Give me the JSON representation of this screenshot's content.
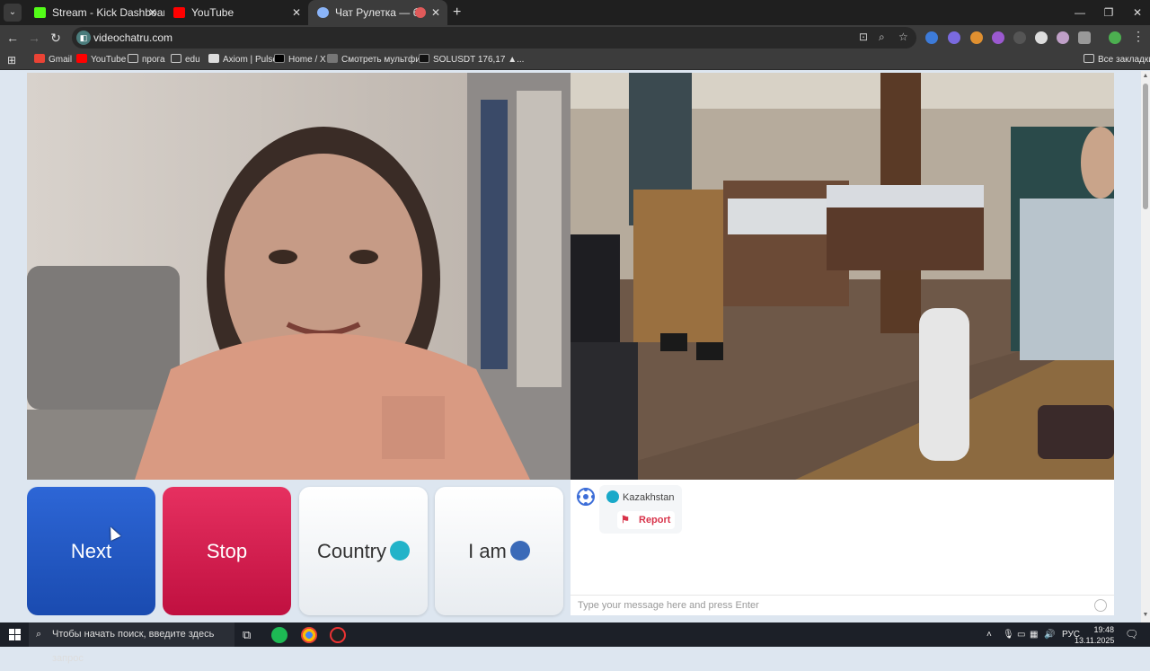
{
  "browser": {
    "tabs": [
      {
        "title": "Stream - Kick Dashboard",
        "favicon": "kick-icon",
        "color": "#53fc18"
      },
      {
        "title": "YouTube",
        "favicon": "youtube-icon",
        "color": "#ff0000"
      },
      {
        "title": "Чат Рулетка — бесплатный",
        "favicon": "chat-icon",
        "color": "#8ab4f8",
        "active": true
      }
    ],
    "url": "videochatru.com",
    "bookmarks": [
      {
        "label": "Gmail",
        "icon": "gmail-icon"
      },
      {
        "label": "YouTube",
        "icon": "youtube-icon"
      },
      {
        "label": "прога",
        "icon": "folder-icon"
      },
      {
        "label": "edu",
        "icon": "folder-icon"
      },
      {
        "label": "Axiom | Pulse",
        "icon": "axiom-icon"
      },
      {
        "label": "Home / X",
        "icon": "x-icon"
      },
      {
        "label": "Смотреть мультфи...",
        "icon": "video-icon"
      },
      {
        "label": "SOLUSDT 176,17 ▲...",
        "icon": "tradingview-icon"
      }
    ],
    "all_bookmarks": "Все закладки"
  },
  "page": {
    "buttons": {
      "next": "Next",
      "stop": "Stop",
      "country": "Country",
      "iam": "I am"
    },
    "chat": {
      "country": "Kazakhstan",
      "report": "Report",
      "placeholder": "Type your message here and press Enter"
    }
  },
  "taskbar": {
    "search_placeholder": "Чтобы начать поиск, введите здесь запрос",
    "language": "РУС",
    "time": "19:48",
    "date": "13.11.2025"
  },
  "colors": {
    "next": "#1f55c0",
    "stop": "#d01e50",
    "page_bg": "#dde6f0"
  }
}
